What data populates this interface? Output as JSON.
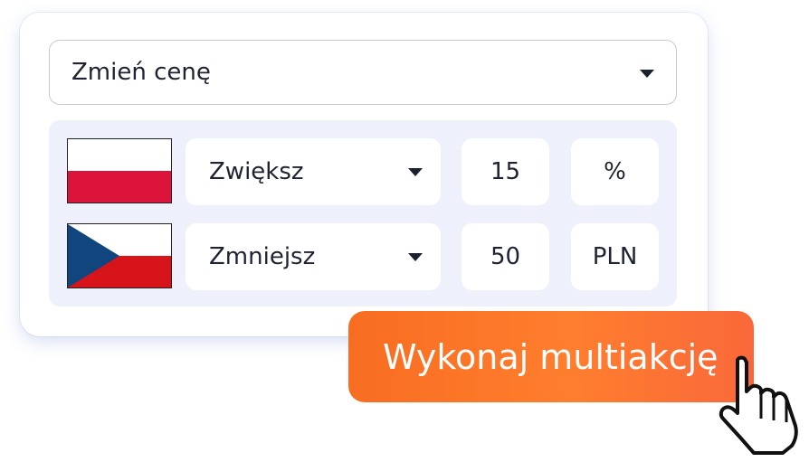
{
  "main_select": {
    "value": "Zmień cenę",
    "icon": "chevron-down-icon"
  },
  "rows": [
    {
      "country_flag": "poland-flag",
      "direction": "Zwiększ",
      "value": "15",
      "unit": "%",
      "flag_colors": [
        "#ffffff",
        "#dc143c"
      ]
    },
    {
      "country_flag": "czech-flag",
      "direction": "Zmniejsz",
      "value": "50",
      "unit": "PLN",
      "flag_colors": [
        "#ffffff",
        "#d7141a",
        "#11457e"
      ]
    }
  ],
  "action_button": {
    "label": "Wykonaj multiakcję",
    "color": "#f86d21"
  },
  "cursor": "hand-pointer-icon",
  "colors": {
    "panel_background": "#eef0fb",
    "text": "#1f2233",
    "accent": "#f86d21"
  }
}
